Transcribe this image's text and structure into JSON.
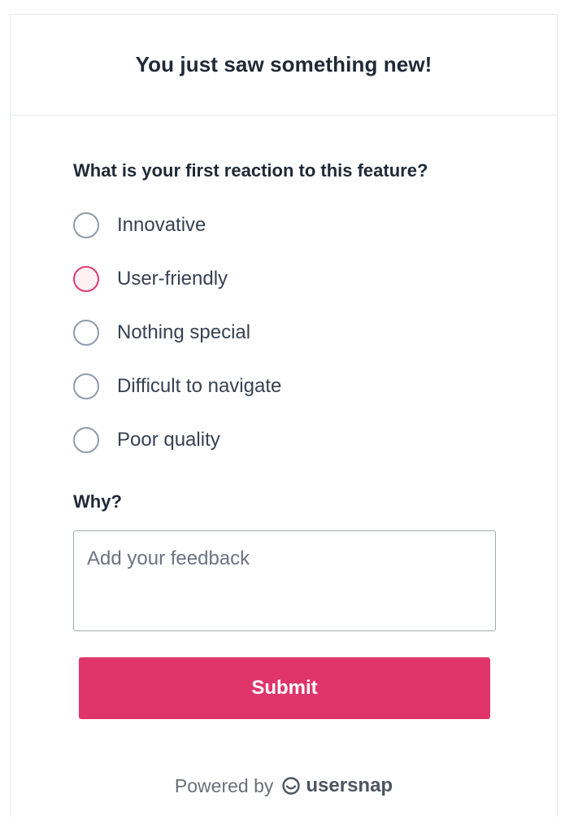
{
  "header": {
    "title": "You just saw something new!"
  },
  "survey": {
    "question": "What is your first reaction to this feature?",
    "options": [
      {
        "label": "Innovative"
      },
      {
        "label": "User-friendly"
      },
      {
        "label": "Nothing special"
      },
      {
        "label": "Difficult to navigate"
      },
      {
        "label": "Poor quality"
      }
    ],
    "focused_option": "User-friendly",
    "why_label": "Why?",
    "feedback": {
      "placeholder": "Add your feedback",
      "value": ""
    },
    "submit_label": "Submit"
  },
  "footer": {
    "powered_by": "Powered by",
    "brand": "usersnap"
  },
  "colors": {
    "accent": "#df356a",
    "radio_border": "#8e9aaa",
    "text_dark": "#1f2937"
  },
  "icons": {
    "brand": "usersnap-logo-icon"
  }
}
